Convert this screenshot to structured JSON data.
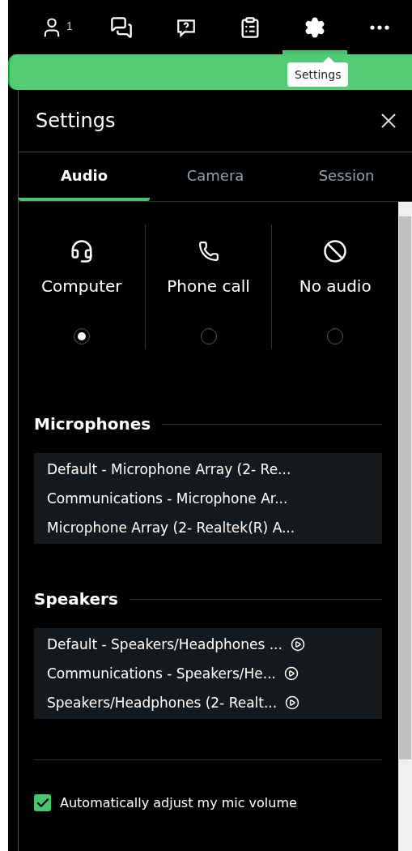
{
  "toolbar": {
    "items": [
      {
        "kind": "people",
        "badge": "1",
        "selected": false
      },
      {
        "kind": "chat",
        "selected": false
      },
      {
        "kind": "questions",
        "selected": false
      },
      {
        "kind": "notes",
        "selected": false
      },
      {
        "kind": "settings",
        "selected": true
      },
      {
        "kind": "more",
        "selected": false
      }
    ],
    "tooltip": "Settings"
  },
  "panel": {
    "title": "Settings",
    "tabs": [
      {
        "label": "Audio",
        "selected": true
      },
      {
        "label": "Camera",
        "selected": false
      },
      {
        "label": "Session",
        "selected": false
      }
    ],
    "audio_options": [
      {
        "kind": "computer",
        "label": "Computer",
        "selected": true
      },
      {
        "kind": "phone",
        "label": "Phone call",
        "selected": false
      },
      {
        "kind": "none",
        "label": "No audio",
        "selected": false
      }
    ],
    "microphones": {
      "heading": "Microphones",
      "devices": [
        {
          "label": "Default - Microphone Array (2- Re..."
        },
        {
          "label": "Communications - Microphone Ar..."
        },
        {
          "label": "Microphone Array (2- Realtek(R) A..."
        }
      ]
    },
    "speakers": {
      "heading": "Speakers",
      "devices": [
        {
          "label": "Default - Speakers/Headphones ..."
        },
        {
          "label": "Communications - Speakers/He..."
        },
        {
          "label": "Speakers/Headphones (2- Realt..."
        }
      ]
    },
    "auto_adjust": {
      "label": "Automatically adjust my mic volume",
      "checked": true
    }
  }
}
